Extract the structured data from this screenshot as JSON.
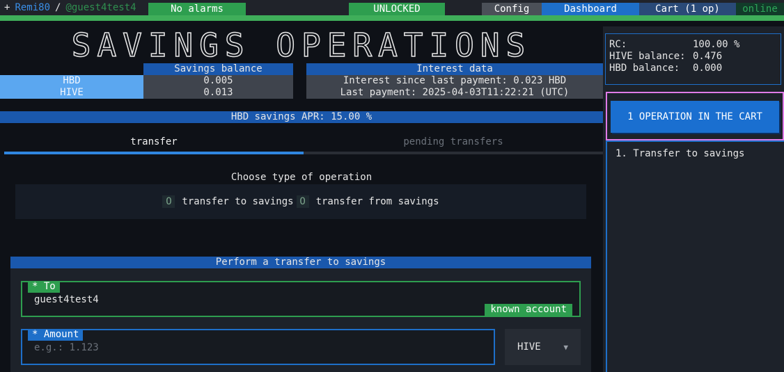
{
  "header": {
    "plus": "+",
    "user": "Remi80",
    "separator": "/",
    "proxy": "@guest4test4",
    "alarms": "No alarms",
    "lock_status": "UNLOCKED",
    "config": "Config",
    "dashboard": "Dashboard",
    "cart": "Cart (1 op)",
    "status": "online"
  },
  "page": {
    "title": "SAVINGS OPERATIONS"
  },
  "savings_balance": {
    "header": "Savings balance",
    "rows": [
      {
        "label": "HBD",
        "value": "0.005"
      },
      {
        "label": "HIVE",
        "value": "0.013"
      }
    ]
  },
  "interest": {
    "header": "Interest data",
    "since_last_payment": "Interest since last payment: 0.023 HBD",
    "last_payment": "Last payment: 2025-04-03T11:22:21 (UTC)"
  },
  "apr": "HBD savings APR: 15.00 %",
  "tabs": [
    {
      "label": "transfer",
      "active": true
    },
    {
      "label": "pending transfers",
      "active": false
    }
  ],
  "operation_type": {
    "title": "Choose type of operation",
    "options": [
      {
        "marker": "O",
        "label": "transfer to savings"
      },
      {
        "marker": "O",
        "label": "transfer from savings"
      }
    ]
  },
  "form": {
    "header": "Perform a transfer to savings",
    "to": {
      "label": "* To",
      "value": "guest4test4",
      "hint": "known account"
    },
    "amount": {
      "label": "* Amount",
      "placeholder": "e.g.: 1.123"
    },
    "currency": {
      "selected": "HIVE",
      "arrow": "▼"
    }
  },
  "side": {
    "stats": [
      {
        "key": "RC:",
        "value": "100.00 %"
      },
      {
        "key": "HIVE balance:",
        "value": "0.476"
      },
      {
        "key": "HBD balance:",
        "value": "0.000"
      }
    ],
    "cart_button": "1 OPERATION IN THE CART",
    "cart_items": [
      "1. Transfer to savings"
    ]
  },
  "colors": {
    "accent_blue": "#1e6fc9",
    "accent_green": "#2e9e4f",
    "highlight_pink": "#e07be8"
  }
}
